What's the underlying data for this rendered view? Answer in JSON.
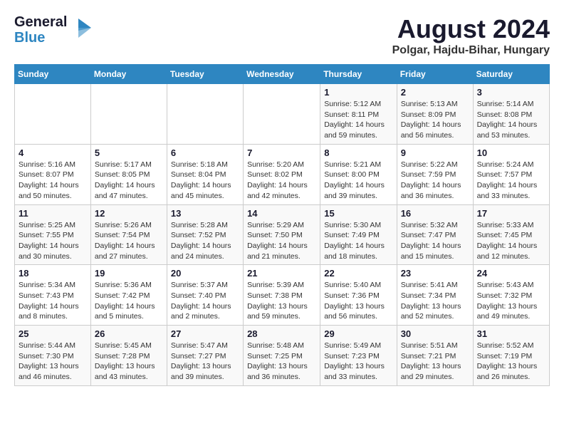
{
  "logo": {
    "general": "General",
    "blue": "Blue",
    "tagline": "▶"
  },
  "header": {
    "month_year": "August 2024",
    "location": "Polgar, Hajdu-Bihar, Hungary"
  },
  "days_of_week": [
    "Sunday",
    "Monday",
    "Tuesday",
    "Wednesday",
    "Thursday",
    "Friday",
    "Saturday"
  ],
  "weeks": [
    [
      {
        "day": "",
        "info": ""
      },
      {
        "day": "",
        "info": ""
      },
      {
        "day": "",
        "info": ""
      },
      {
        "day": "",
        "info": ""
      },
      {
        "day": "1",
        "info": "Sunrise: 5:12 AM\nSunset: 8:11 PM\nDaylight: 14 hours\nand 59 minutes."
      },
      {
        "day": "2",
        "info": "Sunrise: 5:13 AM\nSunset: 8:09 PM\nDaylight: 14 hours\nand 56 minutes."
      },
      {
        "day": "3",
        "info": "Sunrise: 5:14 AM\nSunset: 8:08 PM\nDaylight: 14 hours\nand 53 minutes."
      }
    ],
    [
      {
        "day": "4",
        "info": "Sunrise: 5:16 AM\nSunset: 8:07 PM\nDaylight: 14 hours\nand 50 minutes."
      },
      {
        "day": "5",
        "info": "Sunrise: 5:17 AM\nSunset: 8:05 PM\nDaylight: 14 hours\nand 47 minutes."
      },
      {
        "day": "6",
        "info": "Sunrise: 5:18 AM\nSunset: 8:04 PM\nDaylight: 14 hours\nand 45 minutes."
      },
      {
        "day": "7",
        "info": "Sunrise: 5:20 AM\nSunset: 8:02 PM\nDaylight: 14 hours\nand 42 minutes."
      },
      {
        "day": "8",
        "info": "Sunrise: 5:21 AM\nSunset: 8:00 PM\nDaylight: 14 hours\nand 39 minutes."
      },
      {
        "day": "9",
        "info": "Sunrise: 5:22 AM\nSunset: 7:59 PM\nDaylight: 14 hours\nand 36 minutes."
      },
      {
        "day": "10",
        "info": "Sunrise: 5:24 AM\nSunset: 7:57 PM\nDaylight: 14 hours\nand 33 minutes."
      }
    ],
    [
      {
        "day": "11",
        "info": "Sunrise: 5:25 AM\nSunset: 7:55 PM\nDaylight: 14 hours\nand 30 minutes."
      },
      {
        "day": "12",
        "info": "Sunrise: 5:26 AM\nSunset: 7:54 PM\nDaylight: 14 hours\nand 27 minutes."
      },
      {
        "day": "13",
        "info": "Sunrise: 5:28 AM\nSunset: 7:52 PM\nDaylight: 14 hours\nand 24 minutes."
      },
      {
        "day": "14",
        "info": "Sunrise: 5:29 AM\nSunset: 7:50 PM\nDaylight: 14 hours\nand 21 minutes."
      },
      {
        "day": "15",
        "info": "Sunrise: 5:30 AM\nSunset: 7:49 PM\nDaylight: 14 hours\nand 18 minutes."
      },
      {
        "day": "16",
        "info": "Sunrise: 5:32 AM\nSunset: 7:47 PM\nDaylight: 14 hours\nand 15 minutes."
      },
      {
        "day": "17",
        "info": "Sunrise: 5:33 AM\nSunset: 7:45 PM\nDaylight: 14 hours\nand 12 minutes."
      }
    ],
    [
      {
        "day": "18",
        "info": "Sunrise: 5:34 AM\nSunset: 7:43 PM\nDaylight: 14 hours\nand 8 minutes."
      },
      {
        "day": "19",
        "info": "Sunrise: 5:36 AM\nSunset: 7:42 PM\nDaylight: 14 hours\nand 5 minutes."
      },
      {
        "day": "20",
        "info": "Sunrise: 5:37 AM\nSunset: 7:40 PM\nDaylight: 14 hours\nand 2 minutes."
      },
      {
        "day": "21",
        "info": "Sunrise: 5:39 AM\nSunset: 7:38 PM\nDaylight: 13 hours\nand 59 minutes."
      },
      {
        "day": "22",
        "info": "Sunrise: 5:40 AM\nSunset: 7:36 PM\nDaylight: 13 hours\nand 56 minutes."
      },
      {
        "day": "23",
        "info": "Sunrise: 5:41 AM\nSunset: 7:34 PM\nDaylight: 13 hours\nand 52 minutes."
      },
      {
        "day": "24",
        "info": "Sunrise: 5:43 AM\nSunset: 7:32 PM\nDaylight: 13 hours\nand 49 minutes."
      }
    ],
    [
      {
        "day": "25",
        "info": "Sunrise: 5:44 AM\nSunset: 7:30 PM\nDaylight: 13 hours\nand 46 minutes."
      },
      {
        "day": "26",
        "info": "Sunrise: 5:45 AM\nSunset: 7:28 PM\nDaylight: 13 hours\nand 43 minutes."
      },
      {
        "day": "27",
        "info": "Sunrise: 5:47 AM\nSunset: 7:27 PM\nDaylight: 13 hours\nand 39 minutes."
      },
      {
        "day": "28",
        "info": "Sunrise: 5:48 AM\nSunset: 7:25 PM\nDaylight: 13 hours\nand 36 minutes."
      },
      {
        "day": "29",
        "info": "Sunrise: 5:49 AM\nSunset: 7:23 PM\nDaylight: 13 hours\nand 33 minutes."
      },
      {
        "day": "30",
        "info": "Sunrise: 5:51 AM\nSunset: 7:21 PM\nDaylight: 13 hours\nand 29 minutes."
      },
      {
        "day": "31",
        "info": "Sunrise: 5:52 AM\nSunset: 7:19 PM\nDaylight: 13 hours\nand 26 minutes."
      }
    ]
  ]
}
